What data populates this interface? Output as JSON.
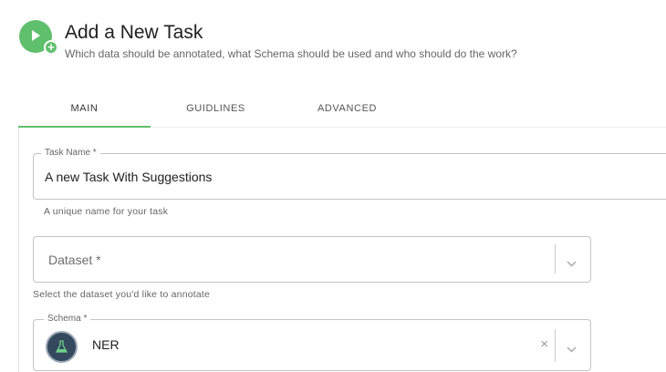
{
  "header": {
    "title": "Add a New Task",
    "subtitle": "Which data should be annotated, what Schema should be used and who should do the work?",
    "logo_icon": "task-add-icon",
    "accent_color": "#5fbf6d"
  },
  "tabs": [
    {
      "label": "MAIN",
      "active": true
    },
    {
      "label": "GUIDLINES",
      "active": false
    },
    {
      "label": "ADVANCED",
      "active": false
    }
  ],
  "form": {
    "task_name": {
      "label": "Task Name *",
      "value": "A new Task With Suggestions",
      "helper": "A unique name for your task"
    },
    "dataset": {
      "placeholder": "Dataset *",
      "helper": "Select the dataset you'd like to annotate"
    },
    "schema": {
      "label": "Schema *",
      "value": "NER",
      "clear_symbol": "×",
      "avatar_icon": "flask-icon"
    }
  }
}
